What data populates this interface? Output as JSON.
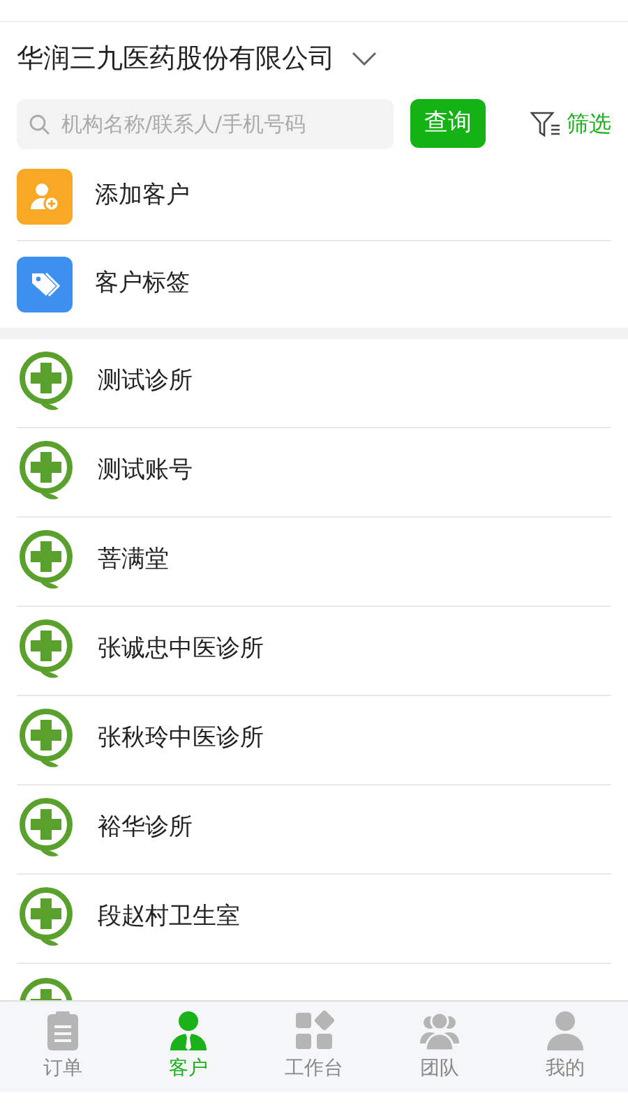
{
  "company": {
    "name": "华润三九医药股份有限公司"
  },
  "search": {
    "placeholder": "机构名称/联系人/手机号码",
    "button": "查询",
    "filter": "筛选"
  },
  "actions": [
    {
      "kind": "add",
      "label": "添加客户"
    },
    {
      "kind": "tag",
      "label": "客户标签"
    }
  ],
  "customers": [
    "测试诊所",
    "测试账号",
    "菩满堂",
    "张诚忠中医诊所",
    "张秋玲中医诊所",
    "裕华诊所",
    "段赵村卫生室"
  ],
  "tabs": [
    {
      "kind": "order",
      "label": "订单",
      "selected": false
    },
    {
      "kind": "customer",
      "label": "客户",
      "selected": true
    },
    {
      "kind": "workbench",
      "label": "工作台",
      "selected": false
    },
    {
      "kind": "team",
      "label": "团队",
      "selected": false
    },
    {
      "kind": "me",
      "label": "我的",
      "selected": false
    }
  ]
}
